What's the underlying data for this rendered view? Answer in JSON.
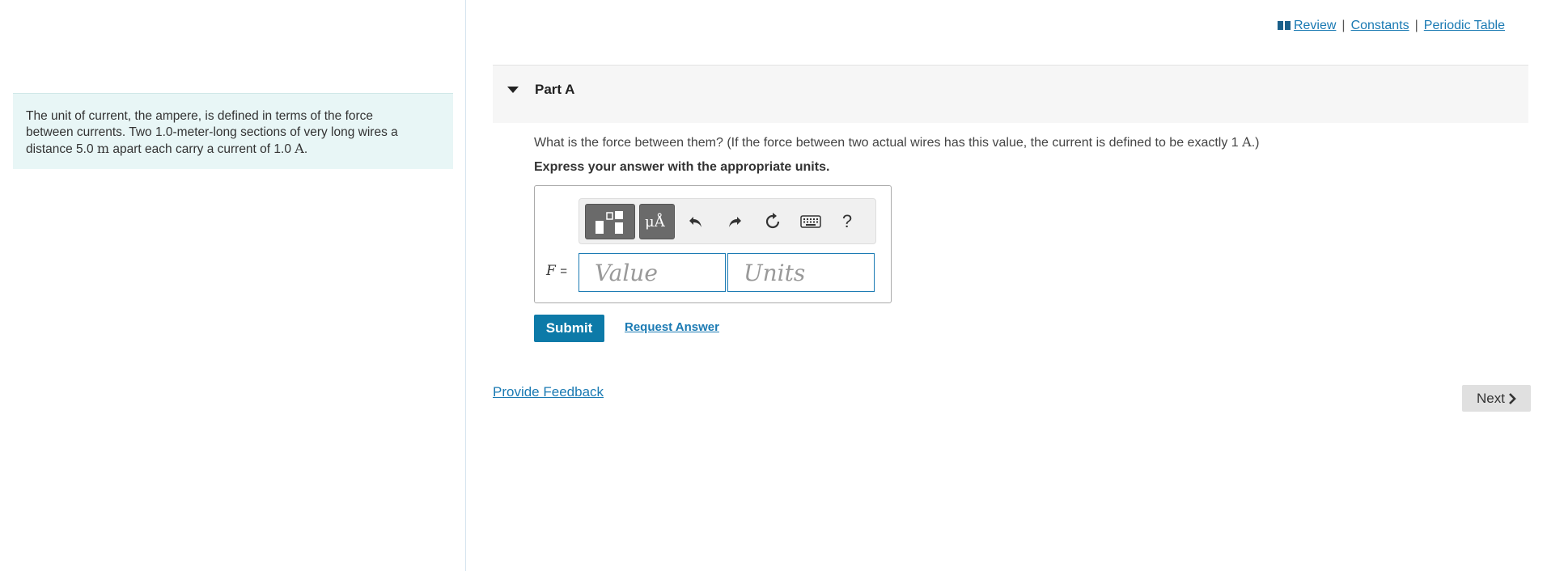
{
  "intro": {
    "line1": "The unit of current, the ampere, is defined in terms of the force",
    "line2": "between currents. Two 1.0-meter-long sections of very long wires a",
    "line3_a": "distance 5.0",
    "line3_unit": "m",
    "line3_b": "apart each carry a current of 1.0",
    "line3_unit2": "A",
    "line3_c": "."
  },
  "top_links": {
    "review": "Review",
    "constants": "Constants",
    "periodic_table": "Periodic Table",
    "separator": "|"
  },
  "part": {
    "title": "Part A",
    "question_a": "What is the force between them? (If the force between two actual wires has this value, the current is defined to be exactly 1",
    "question_unit": "A",
    "question_b": ".)",
    "instruction": "Express your answer with the appropriate units."
  },
  "toolbar": {
    "templates_icon": "templates-icon",
    "units_label": "μÅ",
    "undo_icon": "undo-icon",
    "redo_icon": "redo-icon",
    "reset_icon": "reset-icon",
    "keyboard_icon": "keyboard-icon",
    "help_label": "?"
  },
  "answer": {
    "variable": "F",
    "equals": "=",
    "value_placeholder": "Value",
    "units_placeholder": "Units"
  },
  "actions": {
    "submit": "Submit",
    "request_answer": "Request Answer",
    "provide_feedback": "Provide Feedback",
    "next": "Next"
  },
  "colors": {
    "accent": "#0d7aa8",
    "link": "#1a7ab3",
    "intro_bg": "#e8f6f6"
  }
}
